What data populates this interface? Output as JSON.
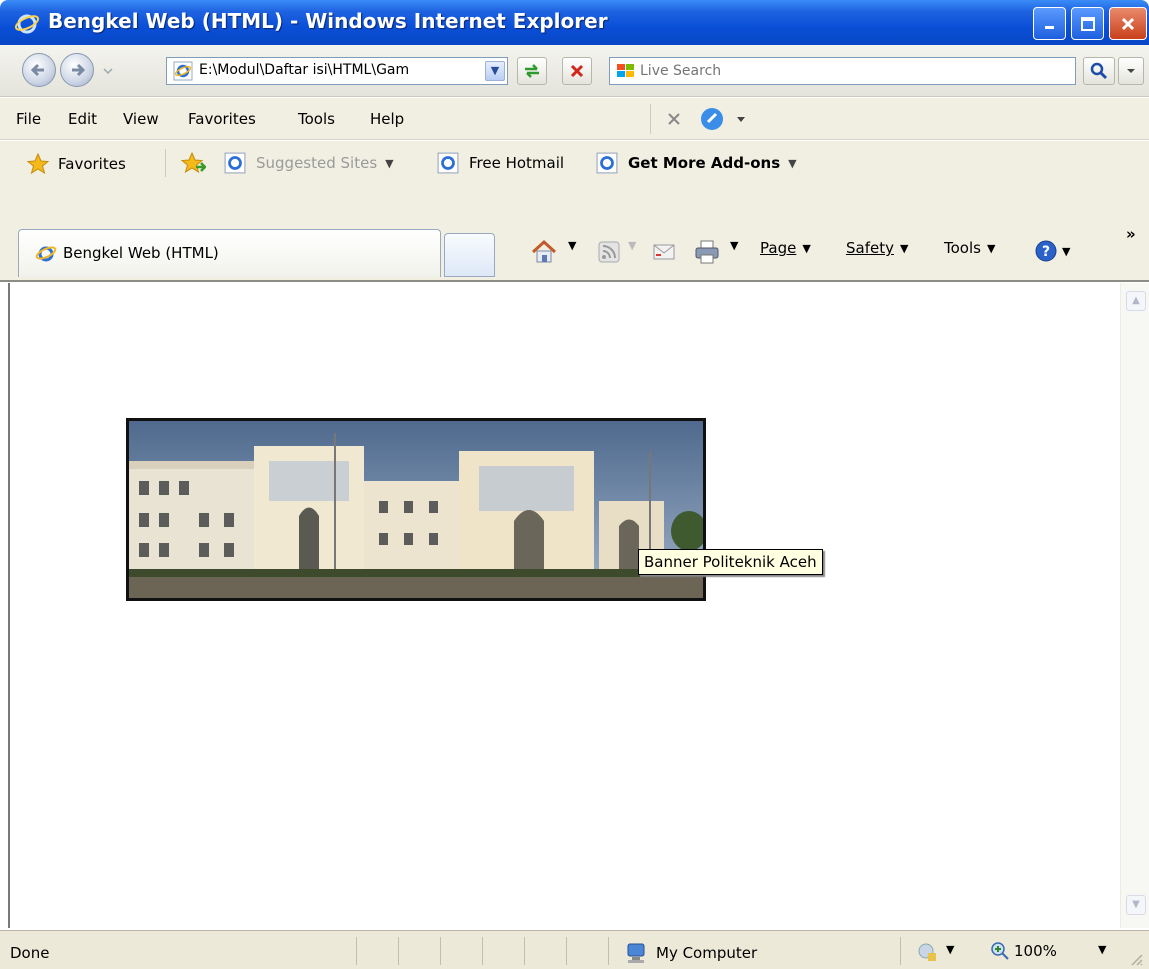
{
  "window": {
    "title": "Bengkel Web (HTML) - Windows Internet Explorer"
  },
  "address_bar": {
    "url": "E:\\Modul\\Daftar isi\\HTML\\Gam"
  },
  "search": {
    "placeholder": "Live Search"
  },
  "menu": {
    "items": [
      {
        "label": "File"
      },
      {
        "label": "Edit"
      },
      {
        "label": "View"
      },
      {
        "label": "Favorites"
      },
      {
        "label": "Tools"
      },
      {
        "label": "Help"
      }
    ]
  },
  "favorites_bar": {
    "favorites_label": "Favorites",
    "suggested_sites": "Suggested Sites",
    "free_hotmail": "Free Hotmail",
    "get_addons": "Get More Add-ons"
  },
  "tab": {
    "label": "Bengkel Web (HTML)"
  },
  "command_bar": {
    "page": "Page",
    "safety": "Safety",
    "tools": "Tools",
    "more": "»"
  },
  "content": {
    "tooltip": "Banner Politeknik Aceh"
  },
  "status_bar": {
    "status": "Done",
    "zone": "My Computer",
    "zoom": "100%"
  }
}
